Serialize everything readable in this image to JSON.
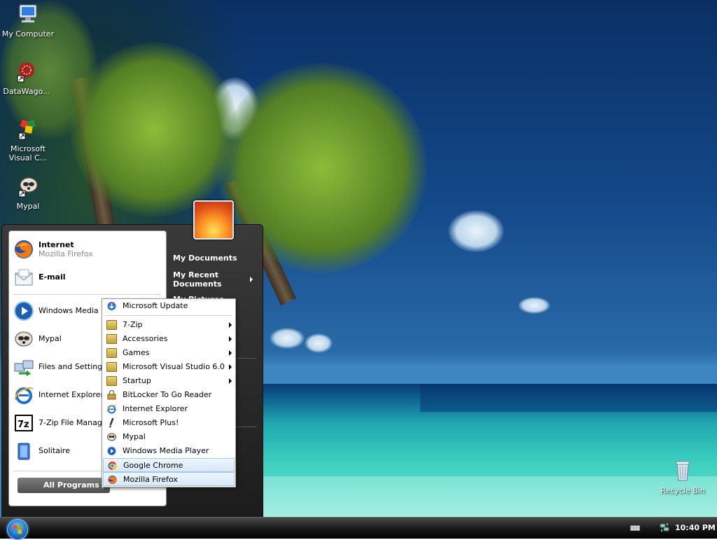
{
  "desktop": {
    "icons": [
      {
        "label": "My Computer",
        "icon": "computer-icon"
      },
      {
        "label": "DataWago...",
        "icon": "datawagon-icon"
      },
      {
        "label": "Microsoft Visual C...",
        "icon": "visual-studio-icon"
      },
      {
        "label": "Mypal",
        "icon": "mypal-icon"
      },
      {
        "label": "Recycle Bin",
        "icon": "recycle-bin-icon"
      }
    ]
  },
  "start_menu": {
    "pinned": [
      {
        "title": "Internet",
        "subtitle": "Mozilla Firefox",
        "icon": "firefox-icon"
      },
      {
        "title": "E-mail",
        "icon": "email-icon"
      }
    ],
    "recent": [
      {
        "label": "Windows Media Player",
        "icon": "media-player-icon"
      },
      {
        "label": "Mypal",
        "icon": "mypal-icon"
      },
      {
        "label": "Files and Settings Transfer Wizard",
        "icon": "transfer-wizard-icon"
      },
      {
        "label": "Internet Explorer",
        "icon": "ie-icon"
      },
      {
        "label": "7-Zip File Manager",
        "icon": "7zip-icon"
      },
      {
        "label": "Solitaire",
        "icon": "solitaire-icon"
      }
    ],
    "all_programs_label": "All Programs",
    "right_items": [
      {
        "label": "My Documents"
      },
      {
        "label": "My Recent Documents",
        "has_arrow": true
      },
      {
        "label": "My Pictures"
      }
    ]
  },
  "submenu": {
    "items": [
      {
        "label": "Microsoft Update",
        "icon": "update-icon",
        "arrow": false
      },
      {
        "label": "7-Zip",
        "icon": "folder-icon",
        "arrow": true
      },
      {
        "label": "Accessories",
        "icon": "folder-icon",
        "arrow": true
      },
      {
        "label": "Games",
        "icon": "folder-icon",
        "arrow": true
      },
      {
        "label": "Microsoft Visual Studio 6.0",
        "icon": "folder-icon",
        "arrow": true
      },
      {
        "label": "Startup",
        "icon": "folder-icon",
        "arrow": true
      },
      {
        "label": "BitLocker To Go Reader",
        "icon": "bitlocker-icon",
        "arrow": false
      },
      {
        "label": "Internet Explorer",
        "icon": "ie-icon",
        "arrow": false
      },
      {
        "label": "Microsoft Plus!",
        "icon": "plus-icon",
        "arrow": false
      },
      {
        "label": "Mypal",
        "icon": "mypal-icon",
        "arrow": false
      },
      {
        "label": "Windows Media Player",
        "icon": "media-player-icon",
        "arrow": false
      },
      {
        "label": "Google Chrome",
        "icon": "chrome-icon",
        "arrow": false,
        "highlighted": true
      },
      {
        "label": "Mozilla Firefox",
        "icon": "firefox-icon",
        "arrow": false,
        "highlighted": true
      }
    ]
  },
  "taskbar": {
    "clock": "10:40 PM"
  }
}
